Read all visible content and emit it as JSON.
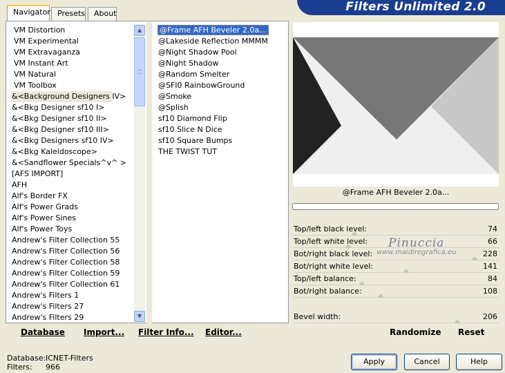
{
  "banner": {
    "title": "Filters Unlimited 2.0"
  },
  "tabs": [
    {
      "label": "Navigator",
      "active": true
    },
    {
      "label": "Presets",
      "active": false
    },
    {
      "label": "About",
      "active": false
    }
  ],
  "categories": [
    "VM Distortion",
    "VM Experimental",
    "VM Extravaganza",
    "VM Instant Art",
    "VM Natural",
    "VM Toolbox",
    "&<Background Designers IV>",
    "&<Bkg Designer sf10 I>",
    "&<Bkg Designer sf10 II>",
    "&<Bkg Designer sf10 III>",
    "&<Bkg Designers sf10 IV>",
    "&<Bkg Kaleidoscope>",
    "&<Sandflower Specials^v^ >",
    "[AFS IMPORT]",
    "AFH",
    "Alf's Border FX",
    "Alf's Power Grads",
    "Alf's Power Sines",
    "Alf's Power Toys",
    "Andrew's Filter Collection 55",
    "Andrew's Filter Collection 56",
    "Andrew's Filter Collection 58",
    "Andrew's Filter Collection 59",
    "Andrew's Filter Collection 61",
    "Andrew's Filters 1",
    "Andrew's Filters 27",
    "Andrew's Filters 29"
  ],
  "highlighted_category": "&<Background Designers IV>",
  "filters": [
    "@Frame AFH Beveler 2.0a...",
    "@Lakeside Reflection MMMM",
    "@Night Shadow Pool",
    "@Night Shadow",
    "@Random Smelter",
    "@SFI0 RainbowGround",
    "@Smoke",
    "@Splish",
    "sf10 Diamond Flip",
    "sf10 Slice N Dice",
    "sf10 Square Bumps",
    "THE TWIST TUT"
  ],
  "selected_filter": "@Frame AFH Beveler 2.0a...",
  "toolbar": {
    "database": "Database",
    "import": "Import...",
    "filter_info": "Filter Info...",
    "editor": "Editor..."
  },
  "preview": {
    "filter_name": "@Frame AFH Beveler 2.0a...",
    "colors": {
      "top": "#777777",
      "left": "#222222",
      "right": "#c8c8c8",
      "bottom": "#efefef"
    }
  },
  "params": [
    {
      "label": "Top/left black level:",
      "value": "74",
      "level": 74
    },
    {
      "label": "Top/left white level:",
      "value": "66",
      "level": 66
    },
    {
      "label": "Bot/right black level:",
      "value": "228",
      "level": 228
    },
    {
      "label": "Bot/right white level:",
      "value": "141",
      "level": 141
    },
    {
      "label": "Top/left balance:",
      "value": "84",
      "level": 84
    },
    {
      "label": "Bot/right balance:",
      "value": "108",
      "level": 108
    }
  ],
  "bevel": {
    "label": "Bevel width:",
    "value": "206",
    "level": 206
  },
  "watermark": {
    "name": "Pinuccia",
    "site": "www.maidiregrafica.eu"
  },
  "actions": {
    "randomize": "Randomize",
    "reset": "Reset"
  },
  "footer": {
    "database_label": "Database:",
    "database_value": "ICNET-Filters",
    "filters_label": "Filters:",
    "filters_value": "966"
  },
  "buttons": {
    "apply": "Apply",
    "cancel": "Cancel",
    "help": "Help"
  }
}
